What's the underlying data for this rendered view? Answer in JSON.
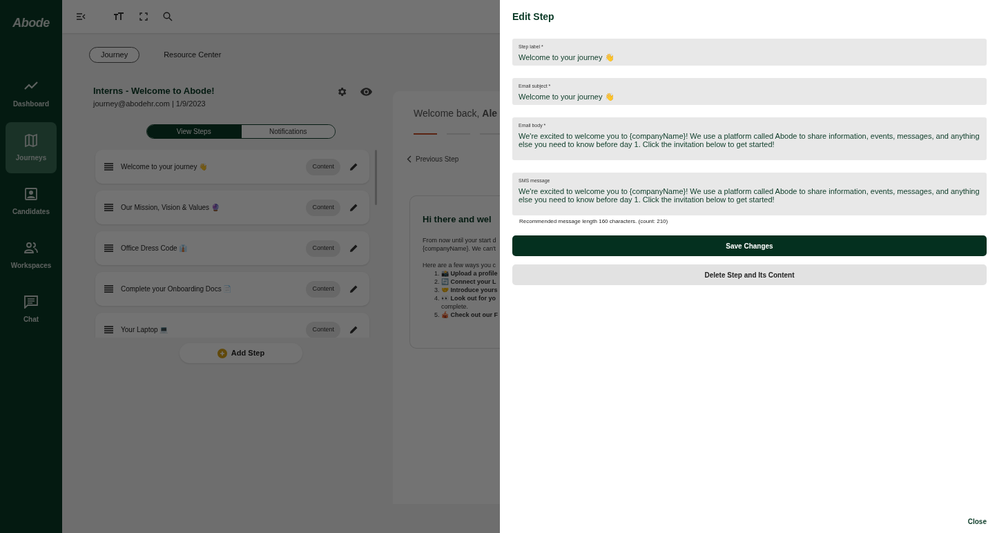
{
  "sidebar": {
    "logo": "Abode",
    "items": [
      {
        "label": "Dashboard",
        "selected": false
      },
      {
        "label": "Journeys",
        "selected": true
      },
      {
        "label": "Candidates",
        "selected": false
      },
      {
        "label": "Workspaces",
        "selected": false
      },
      {
        "label": "Chat",
        "selected": false
      }
    ]
  },
  "tabs": [
    {
      "label": "Journey",
      "selected": true
    },
    {
      "label": "Resource Center",
      "selected": false
    }
  ],
  "journey": {
    "title": "Interns - Welcome to Abode!",
    "subtitle": "journey@abodehr.com | 1/9/2023",
    "view_toggle": [
      {
        "label": "View Steps",
        "selected": true
      },
      {
        "label": "Notifications",
        "selected": false
      }
    ],
    "steps": [
      {
        "label": "Welcome to your journey 👋",
        "tag": "Content"
      },
      {
        "label": "Our Mission, Vision & Values 🔮",
        "tag": "Content"
      },
      {
        "label": "Office Dress Code 👔",
        "tag": "Content"
      },
      {
        "label": "Complete your Onboarding Docs 📄",
        "tag": "Content"
      },
      {
        "label": "Your Laptop 💻",
        "tag": "Content"
      }
    ],
    "add_button": "Add Step"
  },
  "preview": {
    "greeting": "Welcome back, **Ale**",
    "progress": [
      {
        "active": true
      },
      {
        "active": false
      },
      {
        "active": false
      }
    ],
    "back_link": "Previous Step",
    "card": {
      "heading": "Hi there and wel",
      "paragraphs": [
        [
          "From now until your start d",
          "{companyName}. We can't"
        ],
        [
          "Here are a few ways you c"
        ]
      ],
      "list": [
        {
          "number": "1.",
          "text": "📸 **Upload a profile**"
        },
        {
          "number": "2.",
          "text": "🔄 **Connect your L**"
        },
        {
          "number": "3.",
          "text": "🤝 **Introduce yours**"
        },
        {
          "number": "4.",
          "text": "👀 **Look out for yo**",
          "continuation": "complete."
        },
        {
          "number": "5.",
          "text": "🎪 **Check out our F**"
        }
      ]
    }
  },
  "drawer": {
    "title": "Edit Step",
    "fields": [
      {
        "label": "Step label *",
        "value": "Welcome to your journey 👋",
        "kind": "input"
      },
      {
        "label": "Email subject *",
        "value": "Welcome to your journey 👋",
        "kind": "input"
      },
      {
        "label": "Email body *",
        "value": "We're excited to welcome you to {companyName}! We use a platform called Abode to share information, events, messages, and anything else you need to know before day 1. Click the invitation below to get started!",
        "kind": "textarea"
      },
      {
        "label": "SMS message",
        "value": "We're excited to welcome you to {companyName}! We use a platform called Abode to share information, events, messages, and anything else you need to know before day 1. Click the invitation below to get started!",
        "kind": "textarea",
        "hint": "Recommended message length 160 characters. (count: 210)"
      }
    ],
    "buttons": [
      {
        "label": "Save Changes",
        "kind": "primary"
      },
      {
        "label": "Delete Step and Its Content",
        "kind": "secondary"
      }
    ],
    "close": "Close"
  }
}
